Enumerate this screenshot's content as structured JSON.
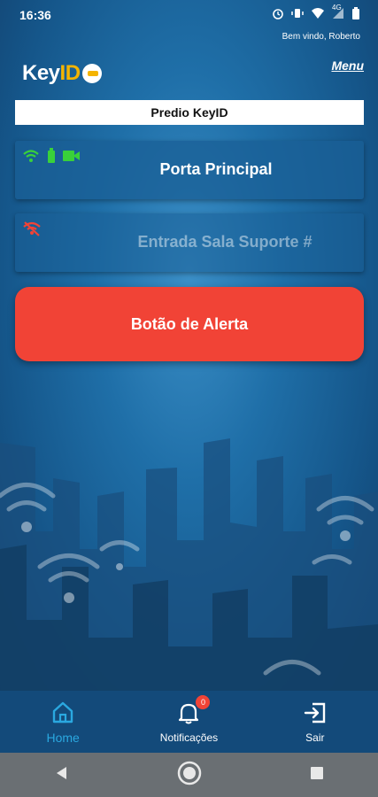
{
  "status_bar": {
    "time": "16:36",
    "network": "4G",
    "icons": [
      "alarm-icon",
      "vibrate-icon",
      "wifi-icon",
      "signal-icon",
      "battery-icon"
    ]
  },
  "header": {
    "welcome": "Bem vindo, Roberto",
    "logo_key": "Key",
    "logo_id": "ID",
    "menu_label": "Menu"
  },
  "building": {
    "name": "Predio KeyID"
  },
  "doors": [
    {
      "title": "Porta Principal",
      "status_icons": [
        "wifi-icon",
        "battery-icon",
        "camera-icon"
      ]
    },
    {
      "title": "Entrada Sala Suporte #",
      "status_icons": [
        "wifi-off-icon"
      ]
    }
  ],
  "alert": {
    "label": "Botão de Alerta"
  },
  "bottom_nav": {
    "items": [
      {
        "label": "Home",
        "icon": "home-icon",
        "active": true
      },
      {
        "label": "Notificações",
        "icon": "bell-icon",
        "badge": "0"
      },
      {
        "label": "Sair",
        "icon": "exit-icon"
      }
    ]
  },
  "colors": {
    "accent": "#2aa8e0",
    "alert": "#f14336",
    "logo_yellow": "#f4b400",
    "nav_bg": "#134a7a"
  }
}
